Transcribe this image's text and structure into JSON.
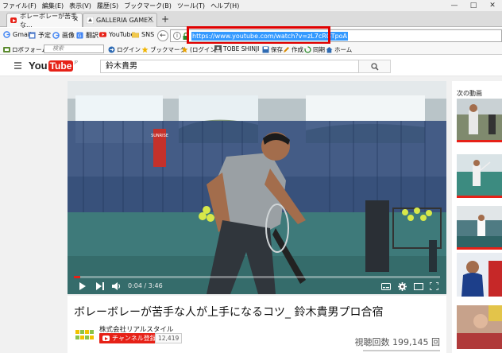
{
  "browser": {
    "menu": [
      "ファイル(F)",
      "編集(E)",
      "表示(V)",
      "履歴(S)",
      "ブックマーク(B)",
      "ツール(T)",
      "ヘルプ(H)"
    ],
    "tabs": [
      {
        "label": "ボレーボレーが苦手な...",
        "active": true
      },
      {
        "label": "GALLERIA GAME...",
        "active": false
      }
    ],
    "url": "https://www.youtube.com/watch?v=zL7cRGTpoA",
    "bookmarks_row1": [
      "Gmail",
      "予定",
      "画像",
      "翻訳",
      "YouTube",
      "SNS"
    ],
    "bookmarks_row2": {
      "item1": "ロボフォーム",
      "search_placeholder": "検索",
      "login": "ログイン",
      "bookmarks": "ブックマーク",
      "login_paren": "(ログイン)",
      "tobe": "TOBE SHINJI",
      "save": "保存",
      "create": "作成",
      "sync": "同期",
      "home": "ホーム"
    },
    "colors": {
      "highlight_box": "#e00000",
      "url_selection": "#3399ff"
    }
  },
  "youtube": {
    "logo_you": "You",
    "logo_tube": "Tube",
    "logo_suffix": "JP",
    "search_value": "鈴木貴男",
    "brand_color": "#e62117",
    "video": {
      "current_time": "0:04",
      "duration": "3:46",
      "progress_fraction": 0.018,
      "banner_text": "SUNRISE"
    },
    "title": "ボレーボレーが苦手な人が上手になるコツ_ 鈴木貴男プロ合宿",
    "channel": {
      "name": "株式会社リアルスタイル",
      "subscribe_label": "チャンネル登録",
      "subscriber_count": "12,419"
    },
    "views": "視聴回数 199,145 回",
    "sidebar": {
      "next_label": "次の動画"
    }
  }
}
